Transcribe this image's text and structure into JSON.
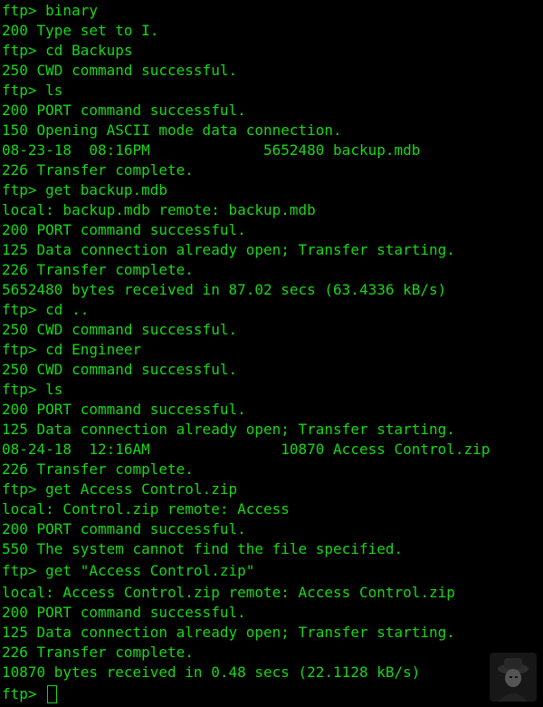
{
  "terminal": {
    "lines": [
      "ftp> binary",
      "200 Type set to I.",
      "ftp> cd Backups",
      "250 CWD command successful.",
      "ftp> ls",
      "200 PORT command successful.",
      "150 Opening ASCII mode data connection.",
      "08-23-18  08:16PM             5652480 backup.mdb",
      "226 Transfer complete.",
      "ftp> get backup.mdb",
      "local: backup.mdb remote: backup.mdb",
      "200 PORT command successful.",
      "125 Data connection already open; Transfer starting.",
      "226 Transfer complete.",
      "5652480 bytes received in 87.02 secs (63.4336 kB/s)",
      "ftp> cd ..",
      "250 CWD command successful.",
      "ftp> cd Engineer",
      "250 CWD command successful.",
      "ftp> ls",
      "200 PORT command successful.",
      "125 Data connection already open; Transfer starting.",
      "08-24-18  12:16AM               10870 Access Control.zip",
      "226 Transfer complete.",
      "ftp> get Access Control.zip",
      "local: Control.zip remote: Access",
      "200 PORT command successful.",
      "550 The system cannot find the file specified.",
      "ftp> get \"Access Control.zip\"",
      "local: Access Control.zip remote: Access Control.zip",
      "200 PORT command successful.",
      "125 Data connection already open; Transfer starting.",
      "226 Transfer complete.",
      "10870 bytes received in 0.48 secs (22.1128 kB/s)"
    ],
    "prompt": "ftp> ",
    "text_color": "#18d818",
    "background_color": "#000000",
    "cursor": "block-cursor"
  },
  "watermark": {
    "icon": "avatar-watermark-icon"
  }
}
